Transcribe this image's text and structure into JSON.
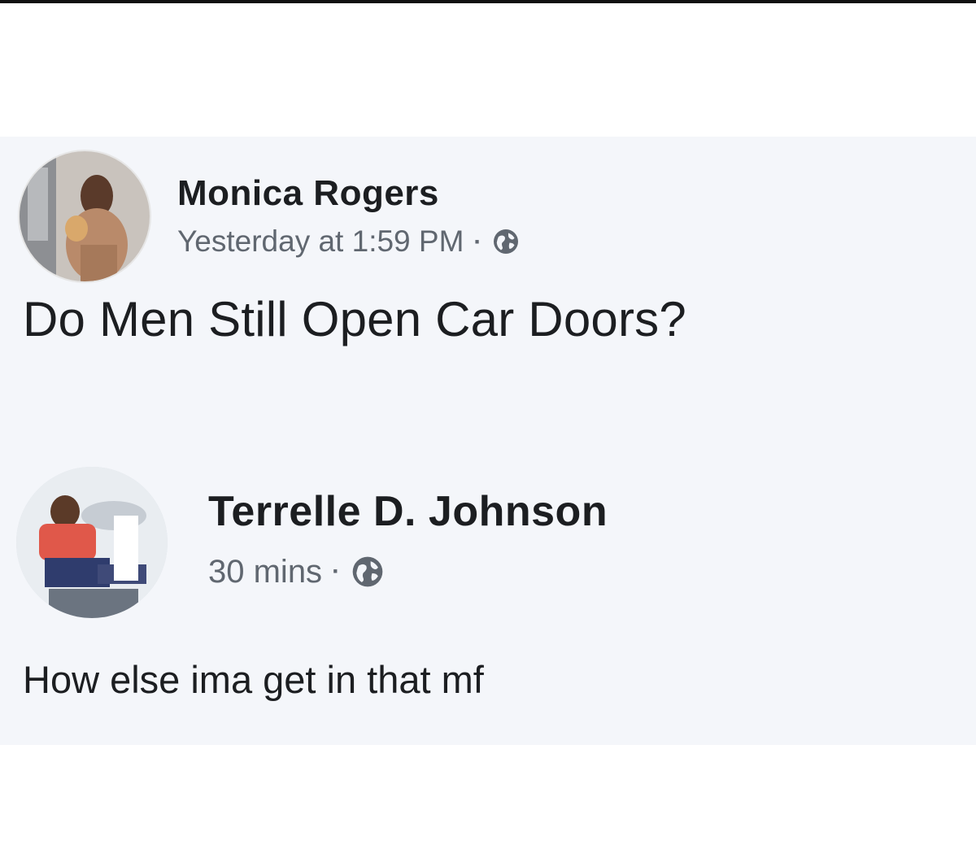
{
  "post": {
    "author_name": "Monica Rogers",
    "timestamp": "Yesterday at 1:59 PM",
    "separator": "·",
    "privacy_icon": "globe-icon",
    "text": "Do Men Still Open Car Doors?"
  },
  "comment": {
    "author_name": "Terrelle D. Johnson",
    "timestamp": "30 mins",
    "separator": "·",
    "privacy_icon": "globe-icon",
    "text": "How else ima get in that mf"
  },
  "colors": {
    "background": "#f4f6fa",
    "name_text": "#1c1e21",
    "meta_text": "#606770"
  }
}
